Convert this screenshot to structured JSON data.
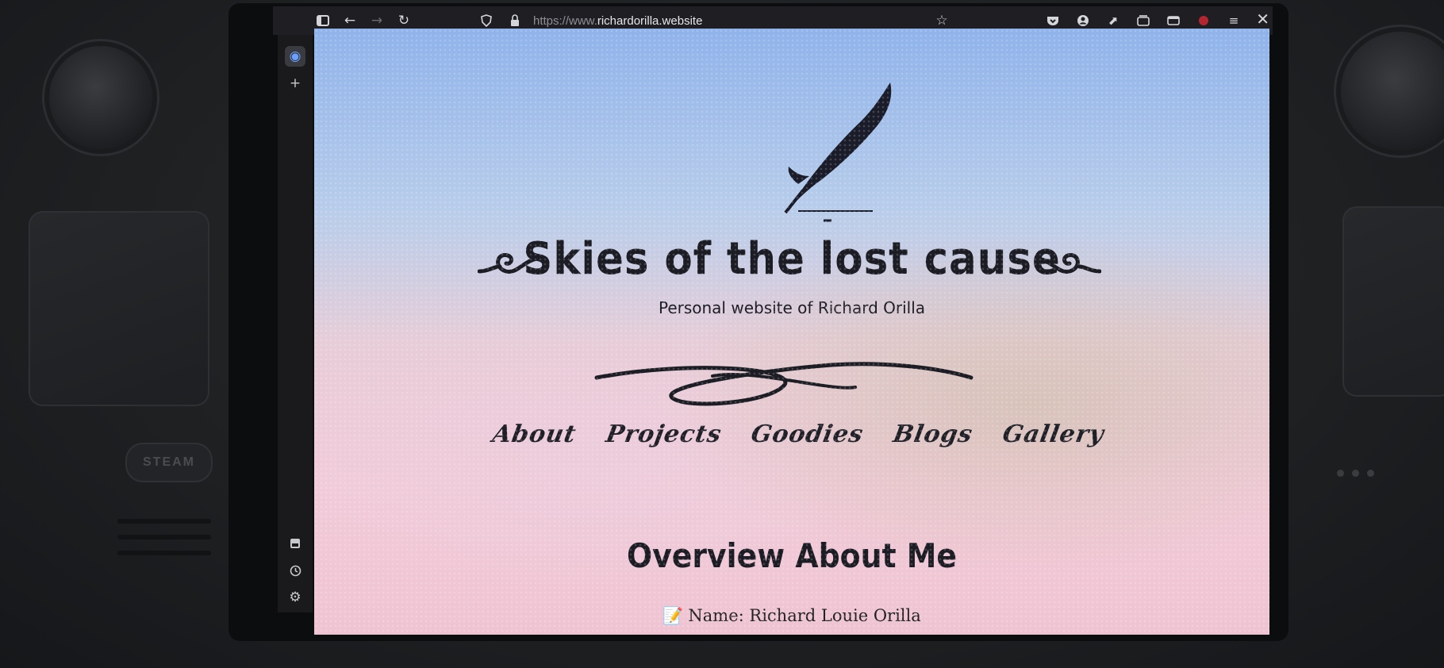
{
  "browser": {
    "url_prefix": "https://www.",
    "url_domain": "richardorilla.website"
  },
  "site": {
    "title": "Skies of the lost cause",
    "subtitle": "Personal website of Richard Orilla",
    "nav": [
      {
        "label": "About"
      },
      {
        "label": "Projects"
      },
      {
        "label": "Goodies"
      },
      {
        "label": "Blogs"
      },
      {
        "label": "Gallery"
      }
    ],
    "section_title": "Overview About Me",
    "name_line": "Name: Richard Louie Orilla"
  },
  "device": {
    "steam_label": "STEAM"
  },
  "colors": {
    "sky_top": "#8fb3ea",
    "sky_pink": "#f1cbd9",
    "ink": "#1c1c24",
    "browser_bar": "#1f1f23"
  }
}
